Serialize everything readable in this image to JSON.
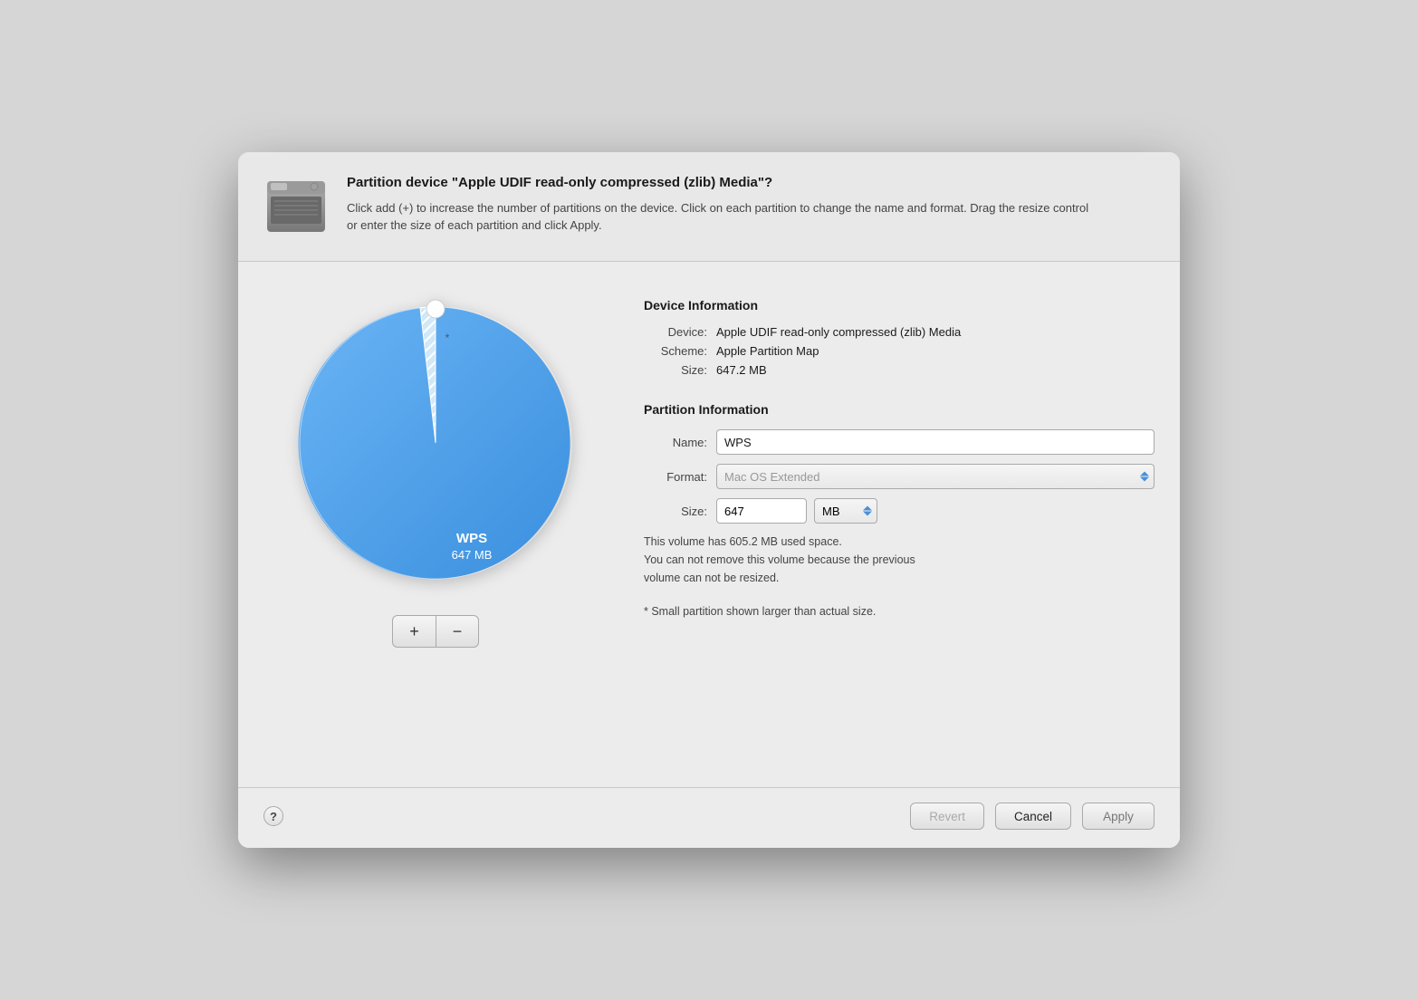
{
  "dialog": {
    "title": "Partition device \"Apple UDIF read-only compressed (zlib) Media\"?",
    "description": "Click add (+) to increase the number of partitions on the device. Click on each partition to change the name and format. Drag the resize control or enter the size of each partition and click Apply."
  },
  "device_info": {
    "section_title": "Device Information",
    "device_label": "Device:",
    "device_value": "Apple UDIF read-only compressed (zlib) Media",
    "scheme_label": "Scheme:",
    "scheme_value": "Apple Partition Map",
    "size_label": "Size:",
    "size_value": "647.2 MB"
  },
  "partition_info": {
    "section_title": "Partition Information",
    "name_label": "Name:",
    "name_value": "WPS",
    "format_label": "Format:",
    "format_placeholder": "Mac OS Extended",
    "size_label": "Size:",
    "size_value": "647",
    "size_unit": "MB",
    "notice_line1": "This volume has 605.2 MB used space.",
    "notice_line2": "You can not remove this volume because the previous",
    "notice_line3": "volume can not be resized."
  },
  "pie_chart": {
    "partition_name": "WPS",
    "partition_size": "647 MB",
    "small_partition_indicator": "*",
    "small_partition_note": "* Small partition shown larger than actual size."
  },
  "controls": {
    "add_label": "+",
    "remove_label": "−"
  },
  "footer": {
    "help_label": "?",
    "revert_label": "Revert",
    "cancel_label": "Cancel",
    "apply_label": "Apply"
  }
}
